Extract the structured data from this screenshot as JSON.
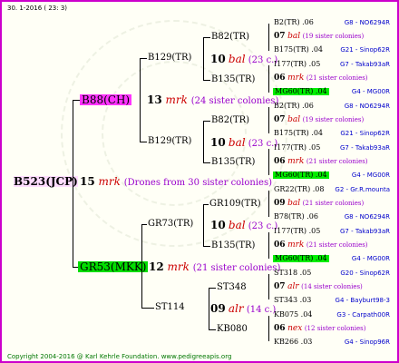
{
  "header": "30.  1-2016 ( 23:  3)",
  "footer": "Copyright 2004-2016 @ Karl Kehrle Foundation.   www.pedigreeapis.org",
  "root": {
    "label": "B523(JCP)"
  },
  "root_mating": {
    "num": "15",
    "mrk": "mrk",
    "desc": "(Drones from 30 sister colonies)"
  },
  "g1_top": {
    "label": "B88(CH)"
  },
  "g1_top_mating": {
    "num": "13",
    "mrk": "mrk",
    "desc": "(24 sister colonies)"
  },
  "g1_bot": {
    "label": "GR53(MKK)"
  },
  "g1_bot_mating": {
    "num": "12",
    "mrk": "mrk",
    "desc": "(21 sister colonies)"
  },
  "g2": {
    "b129a": {
      "label": "B129(TR)"
    },
    "b129b": {
      "label": "B129(TR)"
    },
    "gr73": {
      "label": "GR73(TR)"
    },
    "st114": {
      "label": "ST114"
    }
  },
  "g2_mating": {
    "b129a": {
      "num": "10",
      "mrk": "bal",
      "desc": "(23 c.)"
    },
    "b129b": {
      "num": "10",
      "mrk": "bal",
      "desc": "(23 c.)"
    },
    "gr73": {
      "num": "10",
      "mrk": "bal",
      "desc": "(23 c.)"
    },
    "st114": {
      "num": "09",
      "mrk": "alr",
      "desc": "(14 c.)"
    }
  },
  "g3": {
    "b82a": {
      "label": "B82(TR)"
    },
    "b135a": {
      "label": "B135(TR)"
    },
    "b82b": {
      "label": "B82(TR)"
    },
    "b135b": {
      "label": "B135(TR)"
    },
    "gr109": {
      "label": "GR109(TR)"
    },
    "b135c": {
      "label": "B135(TR)"
    },
    "st348": {
      "label": "ST348"
    },
    "kb080": {
      "label": "KB080"
    }
  },
  "rows": [
    {
      "left": "B2(TR) .06",
      "right": "G8 - NO6294R"
    },
    {
      "num": "07",
      "mrk": "bal",
      "desc": "(19 sister colonies)"
    },
    {
      "left": "B175(TR) .04",
      "right": "G21 - Sinop62R"
    },
    {
      "left": "I177(TR) .05",
      "right": "G7 - Takab93aR"
    },
    {
      "num": "06",
      "mrk": "mrk",
      "desc": "(21 sister colonies)"
    },
    {
      "left": "MG60(TR) .04",
      "right": "G4 - MG00R",
      "hl": true
    },
    {
      "left": "B2(TR) .06",
      "right": "G8 - NO6294R"
    },
    {
      "num": "07",
      "mrk": "bal",
      "desc": "(19 sister colonies)"
    },
    {
      "left": "B175(TR) .04",
      "right": "G21 - Sinop62R"
    },
    {
      "left": "I177(TR) .05",
      "right": "G7 - Takab93aR"
    },
    {
      "num": "06",
      "mrk": "mrk",
      "desc": "(21 sister colonies)"
    },
    {
      "left": "MG60(TR) .04",
      "right": "G4 - MG00R",
      "hl": true
    },
    {
      "left": "GR22(TR) .08",
      "right": "G2 - Gr.R.mounta"
    },
    {
      "num": "09",
      "mrk": "bal",
      "desc": "(21 sister colonies)"
    },
    {
      "left": "B78(TR) .06",
      "right": "G8 - NO6294R"
    },
    {
      "left": "I177(TR) .05",
      "right": "G7 - Takab93aR"
    },
    {
      "num": "06",
      "mrk": "mrk",
      "desc": "(21 sister colonies)"
    },
    {
      "left": "MG60(TR) .04",
      "right": "G4 - MG00R",
      "hl": true
    },
    {
      "left": "ST318 .05",
      "right": "G20 - Sinop62R"
    },
    {
      "num": "07",
      "mrk": "alr",
      "desc": "(14 sister colonies)"
    },
    {
      "left": "ST343 .03",
      "right": "G4 - Bayburt98-3"
    },
    {
      "left": "KB075 .04",
      "right": "G3 - Carpath00R"
    },
    {
      "num": "06",
      "mrk": "nex",
      "desc": "(12 sister colonies)"
    },
    {
      "left": "KB266 .03",
      "right": "G4 - Sinop96R"
    }
  ]
}
